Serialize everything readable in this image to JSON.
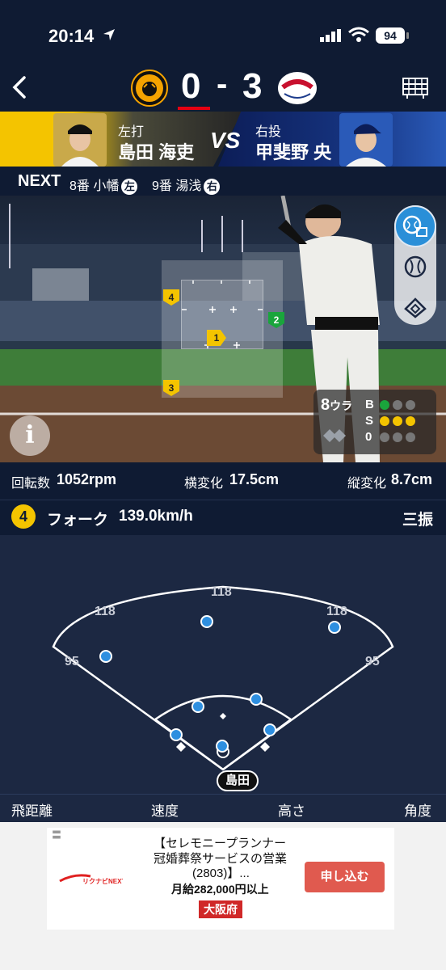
{
  "status_bar": {
    "time": "20:14",
    "battery": "94"
  },
  "scoreboard": {
    "home_score": "0",
    "dash": "-",
    "away_score": "3"
  },
  "matchup": {
    "batter_hand": "左打",
    "batter_name": "島田 海吏",
    "vs": "VS",
    "pitcher_hand": "右投",
    "pitcher_name": "甲斐野 央"
  },
  "next": {
    "label": "NEXT",
    "batter1": "8番 小幡",
    "batter1_hand": "左",
    "batter2": "9番 湯浅",
    "batter2_hand": "右"
  },
  "zone_pins": [
    {
      "no": "4",
      "kind": "yellow"
    },
    {
      "no": "1",
      "kind": "yellow-arrow"
    },
    {
      "no": "2",
      "kind": "green"
    },
    {
      "no": "3",
      "kind": "yellow"
    }
  ],
  "count": {
    "inning": "8",
    "inning_half": "ウラ",
    "ball_label": "B",
    "strike_label": "S",
    "out_label": "0",
    "balls": 1,
    "strikes": 3,
    "outs": 0
  },
  "pitch_stats": {
    "spin_label": "回転数",
    "spin_value": "1052rpm",
    "hbreak_label": "横変化",
    "hbreak_value": "17.5cm",
    "vbreak_label": "縦変化",
    "vbreak_value": "8.7cm"
  },
  "pitch": {
    "number": "4",
    "type": "フォーク",
    "speed": "139.0km/h",
    "result": "三振"
  },
  "spray_chart": {
    "distance_labels": {
      "left_line": "95",
      "left_center": "118",
      "center": "118",
      "right_center": "118",
      "right_line": "95"
    },
    "batter_tag": "島田"
  },
  "spray_footer": {
    "distance": "飛距離",
    "speed": "速度",
    "height": "高さ",
    "angle": "角度"
  },
  "ad": {
    "line1": "【セレモニープランナー",
    "line2": "冠婚葬祭サービスの営業",
    "line3": "(2803)】...",
    "salary": "月給282,000円以上",
    "area": "大阪府",
    "apply": "申し込む",
    "brand": "リクナビNEXT"
  },
  "colors": {
    "accent": "#f4c400",
    "navy": "#0f1b33",
    "score_red": "#e60012",
    "fielder_blue": "#2e8fe0"
  }
}
